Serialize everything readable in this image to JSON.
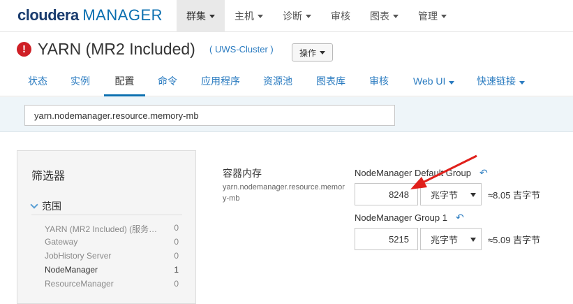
{
  "logo": {
    "part1": "cloudera",
    "part2": "MANAGER"
  },
  "topnav": [
    {
      "label": "群集",
      "active": true
    },
    {
      "label": "主机",
      "active": false
    },
    {
      "label": "诊断",
      "active": false
    },
    {
      "label": "审核",
      "active": false
    },
    {
      "label": "图表",
      "active": false
    },
    {
      "label": "管理",
      "active": false
    }
  ],
  "service": {
    "alert_glyph": "!",
    "title": "YARN (MR2 Included)",
    "cluster": "( UWS-Cluster )",
    "actions_label": "操作"
  },
  "subnav": [
    {
      "label": "状态"
    },
    {
      "label": "实例"
    },
    {
      "label": "配置",
      "active": true
    },
    {
      "label": "命令"
    },
    {
      "label": "应用程序"
    },
    {
      "label": "资源池"
    },
    {
      "label": "图表库"
    },
    {
      "label": "审核"
    },
    {
      "label": "Web UI"
    },
    {
      "label": "快速链接"
    }
  ],
  "search": {
    "value": "yarn.nodemanager.resource.memory-mb"
  },
  "filters": {
    "title": "筛选器",
    "scope_label": "范围",
    "items": [
      {
        "label": "YARN (MR2 Included) (服务…",
        "count": "0"
      },
      {
        "label": "Gateway",
        "count": "0"
      },
      {
        "label": "JobHistory Server",
        "count": "0"
      },
      {
        "label": "NodeManager",
        "count": "1"
      },
      {
        "label": "ResourceManager",
        "count": "0"
      }
    ]
  },
  "config": {
    "label": "容器内存",
    "key": "yarn.nodemanager.resource.memory-mb",
    "groups": [
      {
        "name": "NodeManager Default Group",
        "value": "8248",
        "unit": "兆字节",
        "approx": "≈8.05 吉字节"
      },
      {
        "name": "NodeManager Group 1",
        "value": "5215",
        "unit": "兆字节",
        "approx": "≈5.09 吉字节"
      }
    ]
  },
  "colors": {
    "accent": "#0b6fb0",
    "link": "#2a7bc0",
    "alert": "#cf1f26",
    "arrow": "#e0201b"
  }
}
